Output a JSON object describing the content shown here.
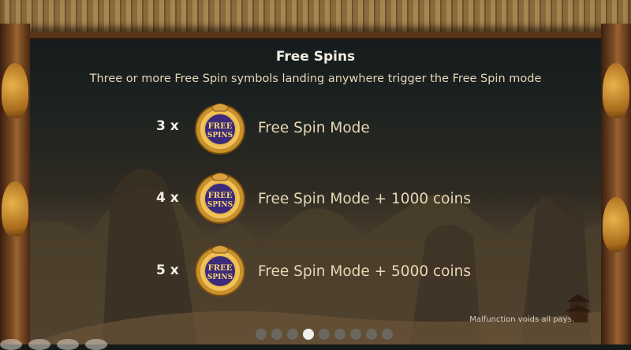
{
  "panel": {
    "title": "Free Spins",
    "subtitle": "Three or more Free Spin symbols landing anywhere trigger the Free Spin mode"
  },
  "symbol": {
    "name": "free-spins-coin-icon",
    "text_line1": "FREE",
    "text_line2": "SPINS"
  },
  "rows": [
    {
      "multiplier": "3 x",
      "description": "Free Spin Mode"
    },
    {
      "multiplier": "4 x",
      "description": "Free Spin Mode + 1000 coins"
    },
    {
      "multiplier": "5 x",
      "description": "Free Spin Mode + 5000 coins"
    }
  ],
  "pager": {
    "total": 9,
    "active": 4
  },
  "footer": {
    "disclaimer": "Malfunction voids all pays."
  }
}
